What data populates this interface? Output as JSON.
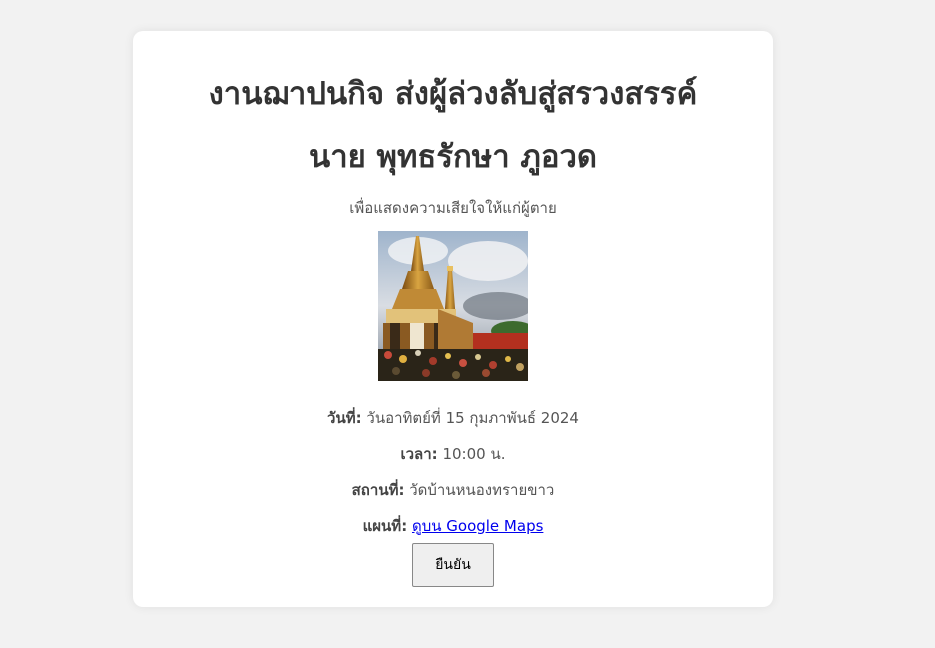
{
  "invitation": {
    "title": "งานฌาปนกิจ ส่งผู้ล่วงลับสู่สรวงสรรค์",
    "deceased_name": "นาย พุทธรักษา ภูอวด",
    "subtitle": "เพื่อแสดงความเสียใจให้แก่ผู้ตาย",
    "image_alt": "temple-photo"
  },
  "details": {
    "date_label": "วันที่:",
    "date_value": "วันอาทิตย์ที่ 15 กุมภาพันธ์ 2024",
    "time_label": "เวลา:",
    "time_value": "10:00 น.",
    "place_label": "สถานที่:",
    "place_value": "วัดบ้านหนองทรายขาว",
    "map_label": "แผนที่:",
    "map_link_text": "ดูบน Google Maps"
  },
  "actions": {
    "confirm_label": "ยืนยัน"
  },
  "colors": {
    "background": "#f2f2f2",
    "card": "#ffffff",
    "link": "#0000ee"
  }
}
